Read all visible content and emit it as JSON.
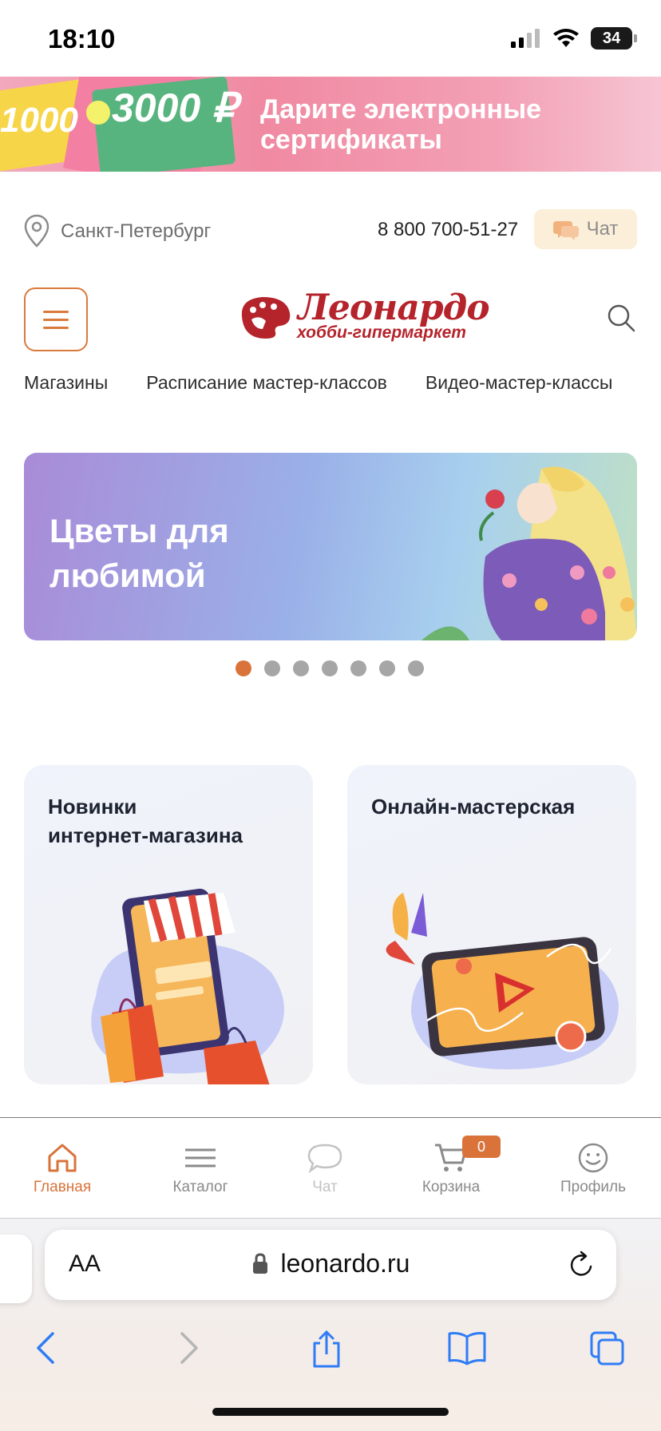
{
  "status_bar": {
    "time": "18:10",
    "battery": "34"
  },
  "promo": {
    "amount_left": "1000",
    "amount_right": "3000 ₽",
    "text_line1": "Дарите электронные",
    "text_line2": "сертификаты"
  },
  "location": {
    "city": "Санкт-Петербург",
    "phone": "8 800 700-51-27",
    "chat_label": "Чат"
  },
  "logo": {
    "name": "Леонардо",
    "subtitle": "хобби-гипермаркет"
  },
  "nav": {
    "items": [
      "Магазины",
      "Расписание мастер-классов",
      "Видео-мастер-классы"
    ]
  },
  "hero": {
    "title_line1": "Цветы для",
    "title_line2": "любимой",
    "slide_count": 7,
    "active_slide": 1
  },
  "cards": [
    {
      "title_line1": "Новинки",
      "title_line2": "интернет-магазина"
    },
    {
      "title_line1": "Онлайн-мастерская",
      "title_line2": ""
    }
  ],
  "tabbar": {
    "items": [
      {
        "label": "Главная",
        "icon": "home-icon",
        "state": "active"
      },
      {
        "label": "Каталог",
        "icon": "catalog-icon",
        "state": "normal"
      },
      {
        "label": "Чат",
        "icon": "chat-icon",
        "state": "disabled"
      },
      {
        "label": "Корзина",
        "icon": "cart-icon",
        "state": "normal"
      },
      {
        "label": "Профиль",
        "icon": "profile-icon",
        "state": "normal"
      }
    ],
    "cart_count": "0"
  },
  "safari": {
    "aa_label": "AA",
    "url": "leonardo.ru"
  },
  "colors": {
    "accent": "#d9733a",
    "brand_red": "#b5232b",
    "chat_bg": "#fbefd9"
  }
}
